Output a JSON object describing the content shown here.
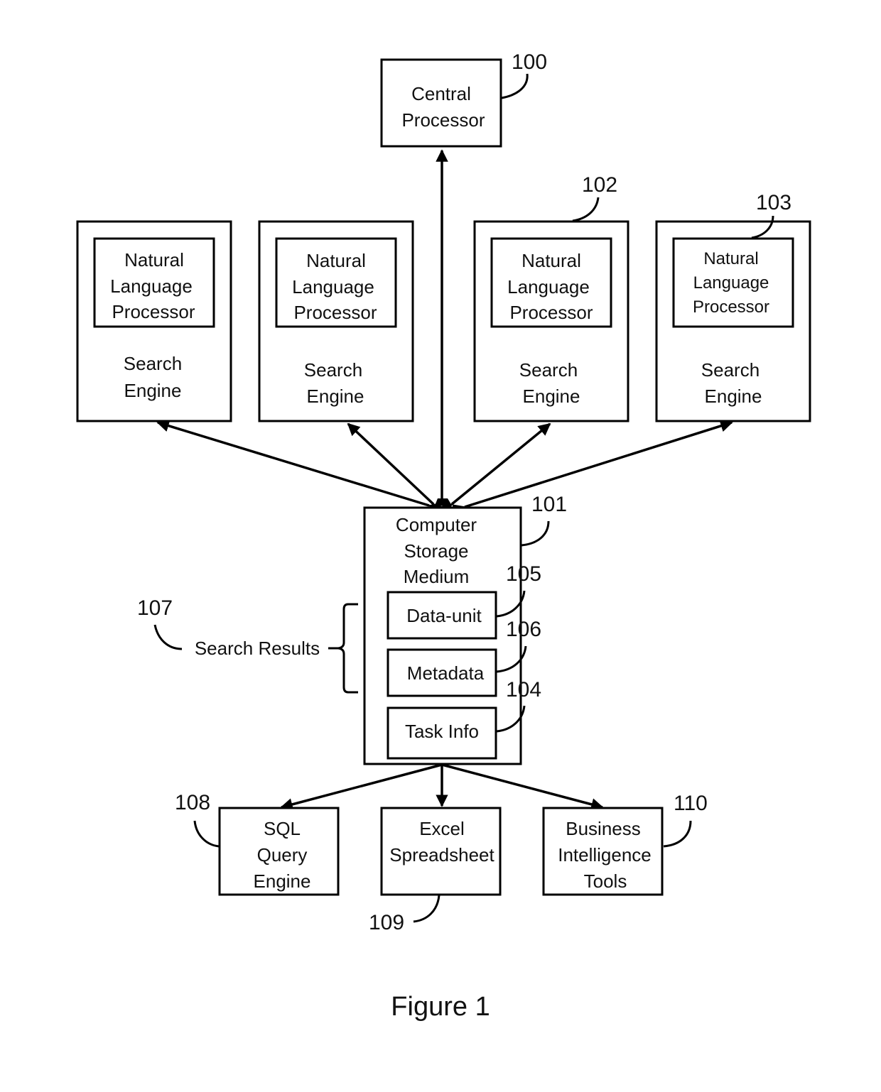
{
  "figure": {
    "caption": "Figure 1",
    "colors": {
      "stroke": "#000000",
      "text": "#111111",
      "background": "#ffffff"
    }
  },
  "central_processor": {
    "ref": "100",
    "lines": [
      "Central",
      "Processor"
    ]
  },
  "search_engines": [
    {
      "ref": "",
      "nlp_lines": [
        "Natural",
        "Language",
        "Processor"
      ],
      "engine_lines": [
        "Search",
        "Engine"
      ]
    },
    {
      "ref": "",
      "nlp_lines": [
        "Natural",
        "Language",
        "Processor"
      ],
      "engine_lines": [
        "Search",
        "Engine"
      ]
    },
    {
      "ref": "102",
      "nlp_lines": [
        "Natural",
        "Language",
        "Processor"
      ],
      "engine_lines": [
        "Search",
        "Engine"
      ]
    },
    {
      "ref": "103",
      "nlp_lines": [
        "Natural",
        "Language",
        "Processor"
      ],
      "engine_lines": [
        "Search",
        "Engine"
      ]
    }
  ],
  "storage": {
    "ref": "101",
    "lines": [
      "Computer",
      "Storage",
      "Medium"
    ],
    "items": [
      {
        "ref": "105",
        "label": "Data-unit"
      },
      {
        "ref": "106",
        "label": "Metadata"
      },
      {
        "ref": "104",
        "label": "Task Info"
      }
    ],
    "bracket": {
      "ref": "107",
      "label": "Search Results"
    }
  },
  "outputs": [
    {
      "ref": "108",
      "lines": [
        "SQL",
        "Query",
        "Engine"
      ]
    },
    {
      "ref": "109",
      "lines": [
        "Excel",
        "Spreadsheet"
      ]
    },
    {
      "ref": "110",
      "lines": [
        "Business",
        "Intelligence",
        "Tools"
      ]
    }
  ]
}
